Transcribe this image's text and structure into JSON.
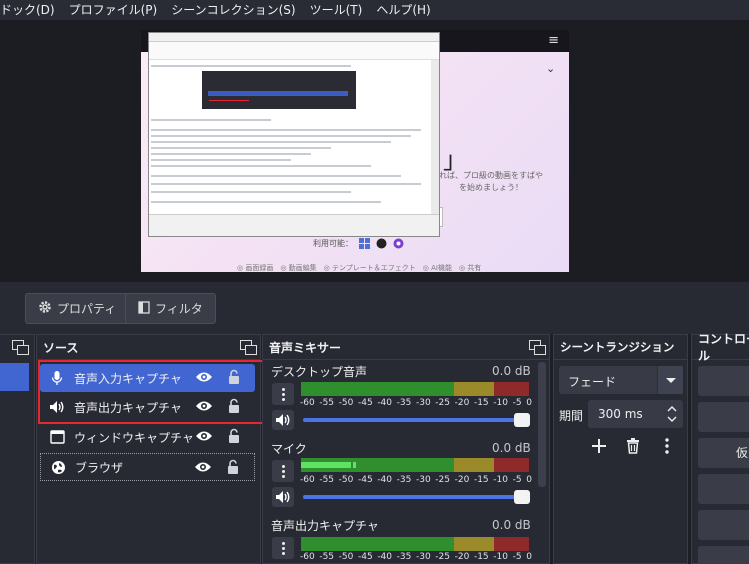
{
  "menubar": {
    "items": [
      "ドック(D)",
      "プロファイル(P)",
      "シーンコレクション(S)",
      "ツール(T)",
      "ヘルプ(H)"
    ]
  },
  "preview": {
    "headline": "」",
    "line1": "れば、プロ級の動画をすばや",
    "line2": "を始めましょう！",
    "available": "利用可能：",
    "features": "◎ 画面録画　◎ 動画編集　◎ テンプレート＆エフェクト　◎ AI機能　◎ 共有"
  },
  "propbar": {
    "properties": "プロパティ",
    "filters": "フィルタ"
  },
  "sources": {
    "title": "ソース",
    "items": [
      {
        "label": "音声入力キャプチャ",
        "icon": "microphone-icon",
        "selected": true
      },
      {
        "label": "音声出力キャプチャ",
        "icon": "speaker-icon",
        "selected": false
      },
      {
        "label": "ウィンドウキャプチャ",
        "icon": "window-icon",
        "selected": false
      },
      {
        "label": "ブラウザ",
        "icon": "globe-icon",
        "selected": false
      }
    ]
  },
  "mixer": {
    "title": "音声ミキサー",
    "ticks": [
      "-60",
      "-55",
      "-50",
      "-45",
      "-40",
      "-35",
      "-30",
      "-25",
      "-20",
      "-15",
      "-10",
      "-5",
      "0"
    ],
    "channels": [
      {
        "name": "デスクトップ音声",
        "db": "0.0 dB",
        "level": 0
      },
      {
        "name": "マイク",
        "db": "0.0 dB",
        "level": 0.2
      },
      {
        "name": "音声出力キャプチャ",
        "db": "0.0 dB",
        "level": 0
      }
    ]
  },
  "transitions": {
    "title": "シーントランジション",
    "selected": "フェード",
    "duration_label": "期間",
    "duration_value": "300 ms"
  },
  "controls": {
    "title": "コントロール",
    "button_partial": "仮"
  },
  "colors": {
    "accent": "#4166d1",
    "highlight": "#e8262f",
    "meter_green": "#2f8f2f",
    "meter_yellow": "#9a8a2a",
    "meter_red": "#8f2a2a"
  }
}
